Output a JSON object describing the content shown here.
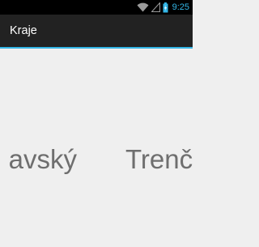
{
  "status_bar": {
    "time": "9:25",
    "icons": [
      "wifi-icon",
      "signal-icon",
      "battery-charging-icon"
    ],
    "accent_color": "#33b5e5"
  },
  "action_bar": {
    "title": "Kraje",
    "background": "#222222",
    "divider_color": "#33b5e5"
  },
  "pager": {
    "pages": [
      {
        "label": "avský"
      },
      {
        "label": "Trenč"
      }
    ],
    "text_color": "#6e6e6e"
  }
}
